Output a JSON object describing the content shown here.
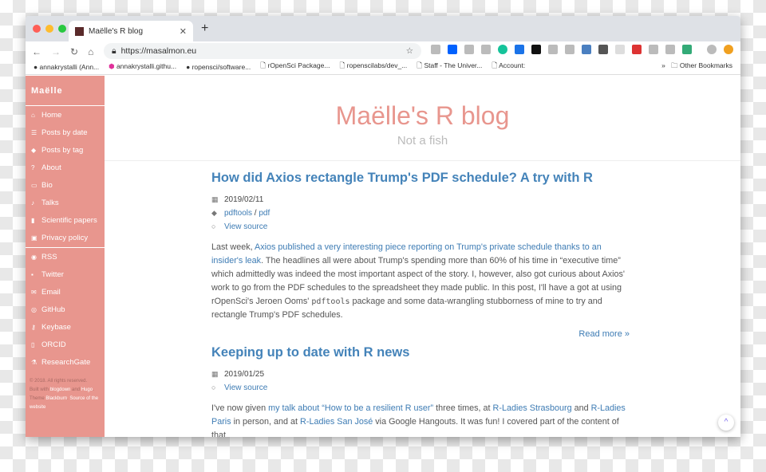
{
  "browser": {
    "tab_title": "Maëlle's R blog",
    "url": "https://masalmon.eu",
    "bookmarks": [
      "annakrystalli (Ann...",
      "annakrystalli.githu...",
      "ropensci/software...",
      "rOpenSci Package...",
      "ropenscilabs/dev_...",
      "Staff - The Univer...",
      "Account:"
    ],
    "other_bookmarks": "Other Bookmarks"
  },
  "sidebar": {
    "brand": "Maëlle",
    "items": [
      {
        "icon": "home",
        "label": "Home"
      },
      {
        "icon": "list",
        "label": "Posts by date"
      },
      {
        "icon": "tags",
        "label": "Posts by tag"
      },
      {
        "icon": "question-circle",
        "label": "About"
      },
      {
        "icon": "id-card",
        "label": "Bio"
      },
      {
        "icon": "microphone",
        "label": "Talks"
      },
      {
        "icon": "file",
        "label": "Scientific papers"
      },
      {
        "icon": "lock",
        "label": "Privacy policy"
      }
    ],
    "social": [
      {
        "icon": "rss",
        "label": "RSS"
      },
      {
        "icon": "twitter",
        "label": "Twitter"
      },
      {
        "icon": "envelope",
        "label": "Email"
      },
      {
        "icon": "github",
        "label": "GitHub"
      },
      {
        "icon": "key",
        "label": "Keybase"
      },
      {
        "icon": "orcid",
        "label": "ORCID"
      },
      {
        "icon": "flask",
        "label": "ResearchGate"
      }
    ],
    "footer": {
      "copyright": "© 2018. All rights reserved.",
      "built_with": "Built with",
      "blogdown": "blogdown",
      "and": "and",
      "hugo": "Hugo",
      "theme": ". Theme",
      "blackburn": "Blackburn",
      "source": "Source of the website"
    }
  },
  "header": {
    "title": "Maëlle's R blog",
    "subtitle": "Not a fish"
  },
  "posts": [
    {
      "title": "How did Axios rectangle Trump's PDF schedule? A try with R",
      "date": "2019/02/11",
      "tags": [
        "pdftools",
        "pdf"
      ],
      "tag_sep": " / ",
      "view_source": "View source",
      "p": [
        "Last week, ",
        "Axios published a very interesting piece reporting on Trump's private schedule thanks to an insider's leak",
        ". The headlines all were about Trump's spending more than 60% of his time in “executive time” which admittedly was indeed the most important aspect of the story. I, however, also got curious about Axios' work to go from the PDF schedules to the spreadsheet they made public. In this post, I'll have a got at using rOpenSci's Jeroen Ooms' ",
        "pdftools",
        " package and some data-wrangling stubborness of mine to try and rectangle Trump's PDF schedules."
      ],
      "read_more": "Read more »"
    },
    {
      "title": "Keeping up to date with R news",
      "date": "2019/01/25",
      "view_source": "View source",
      "p": [
        "I've now given ",
        "my talk about “How to be a resilient R user”",
        " three times, at ",
        "R-Ladies Strasbourg",
        " and ",
        "R-Ladies Paris",
        " in person, and at ",
        "R-Ladies San José",
        " via Google Hangouts. It was fun! I covered part of the content of that"
      ]
    }
  ],
  "colors": {
    "sidebar": "#e8968e",
    "link": "#3e7cb4"
  }
}
